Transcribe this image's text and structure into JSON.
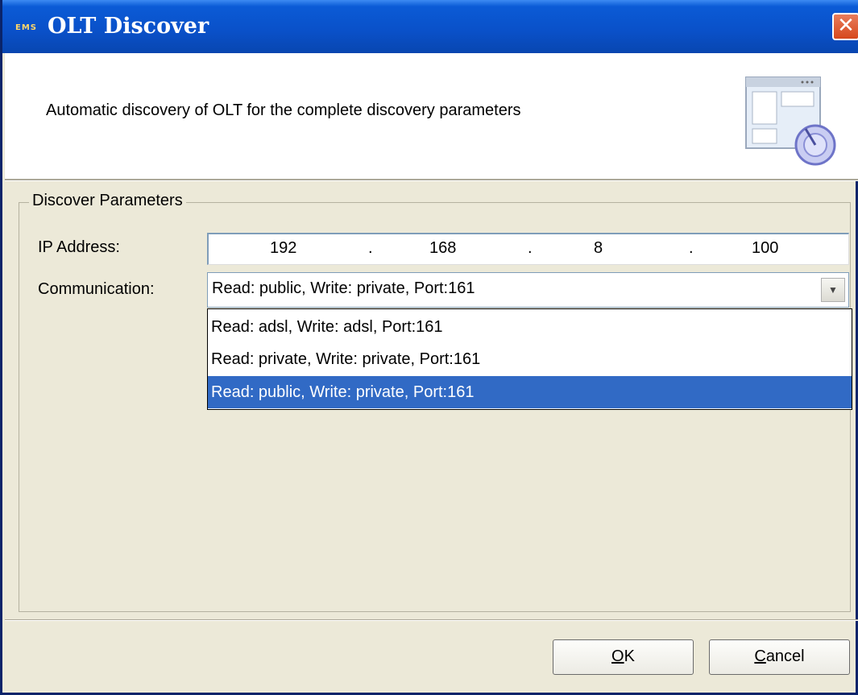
{
  "window": {
    "title": "OLT Discover",
    "app_badge": "EMS",
    "close_label": "✕"
  },
  "header": {
    "description": "Automatic discovery of OLT for the complete discovery parameters",
    "icon": "window-discover-icon"
  },
  "group": {
    "title": "Discover Parameters"
  },
  "ip": {
    "label": "IP Address:",
    "octets": [
      "192",
      "168",
      "8",
      "100"
    ],
    "separator": "."
  },
  "communication": {
    "label": "Communication:",
    "selected": "Read: public, Write: private, Port:161",
    "options": [
      "Read: adsl, Write: adsl, Port:161",
      "Read: private, Write: private, Port:161",
      "Read: public, Write: private, Port:161"
    ],
    "highlighted_index": 2
  },
  "buttons": {
    "ok": {
      "mnemonic": "O",
      "rest": "K"
    },
    "cancel": {
      "mnemonic": "C",
      "rest": "ancel"
    }
  },
  "colors": {
    "titlebar": "#0a50c8",
    "selection": "#316ac5",
    "close": "#d6481c"
  }
}
